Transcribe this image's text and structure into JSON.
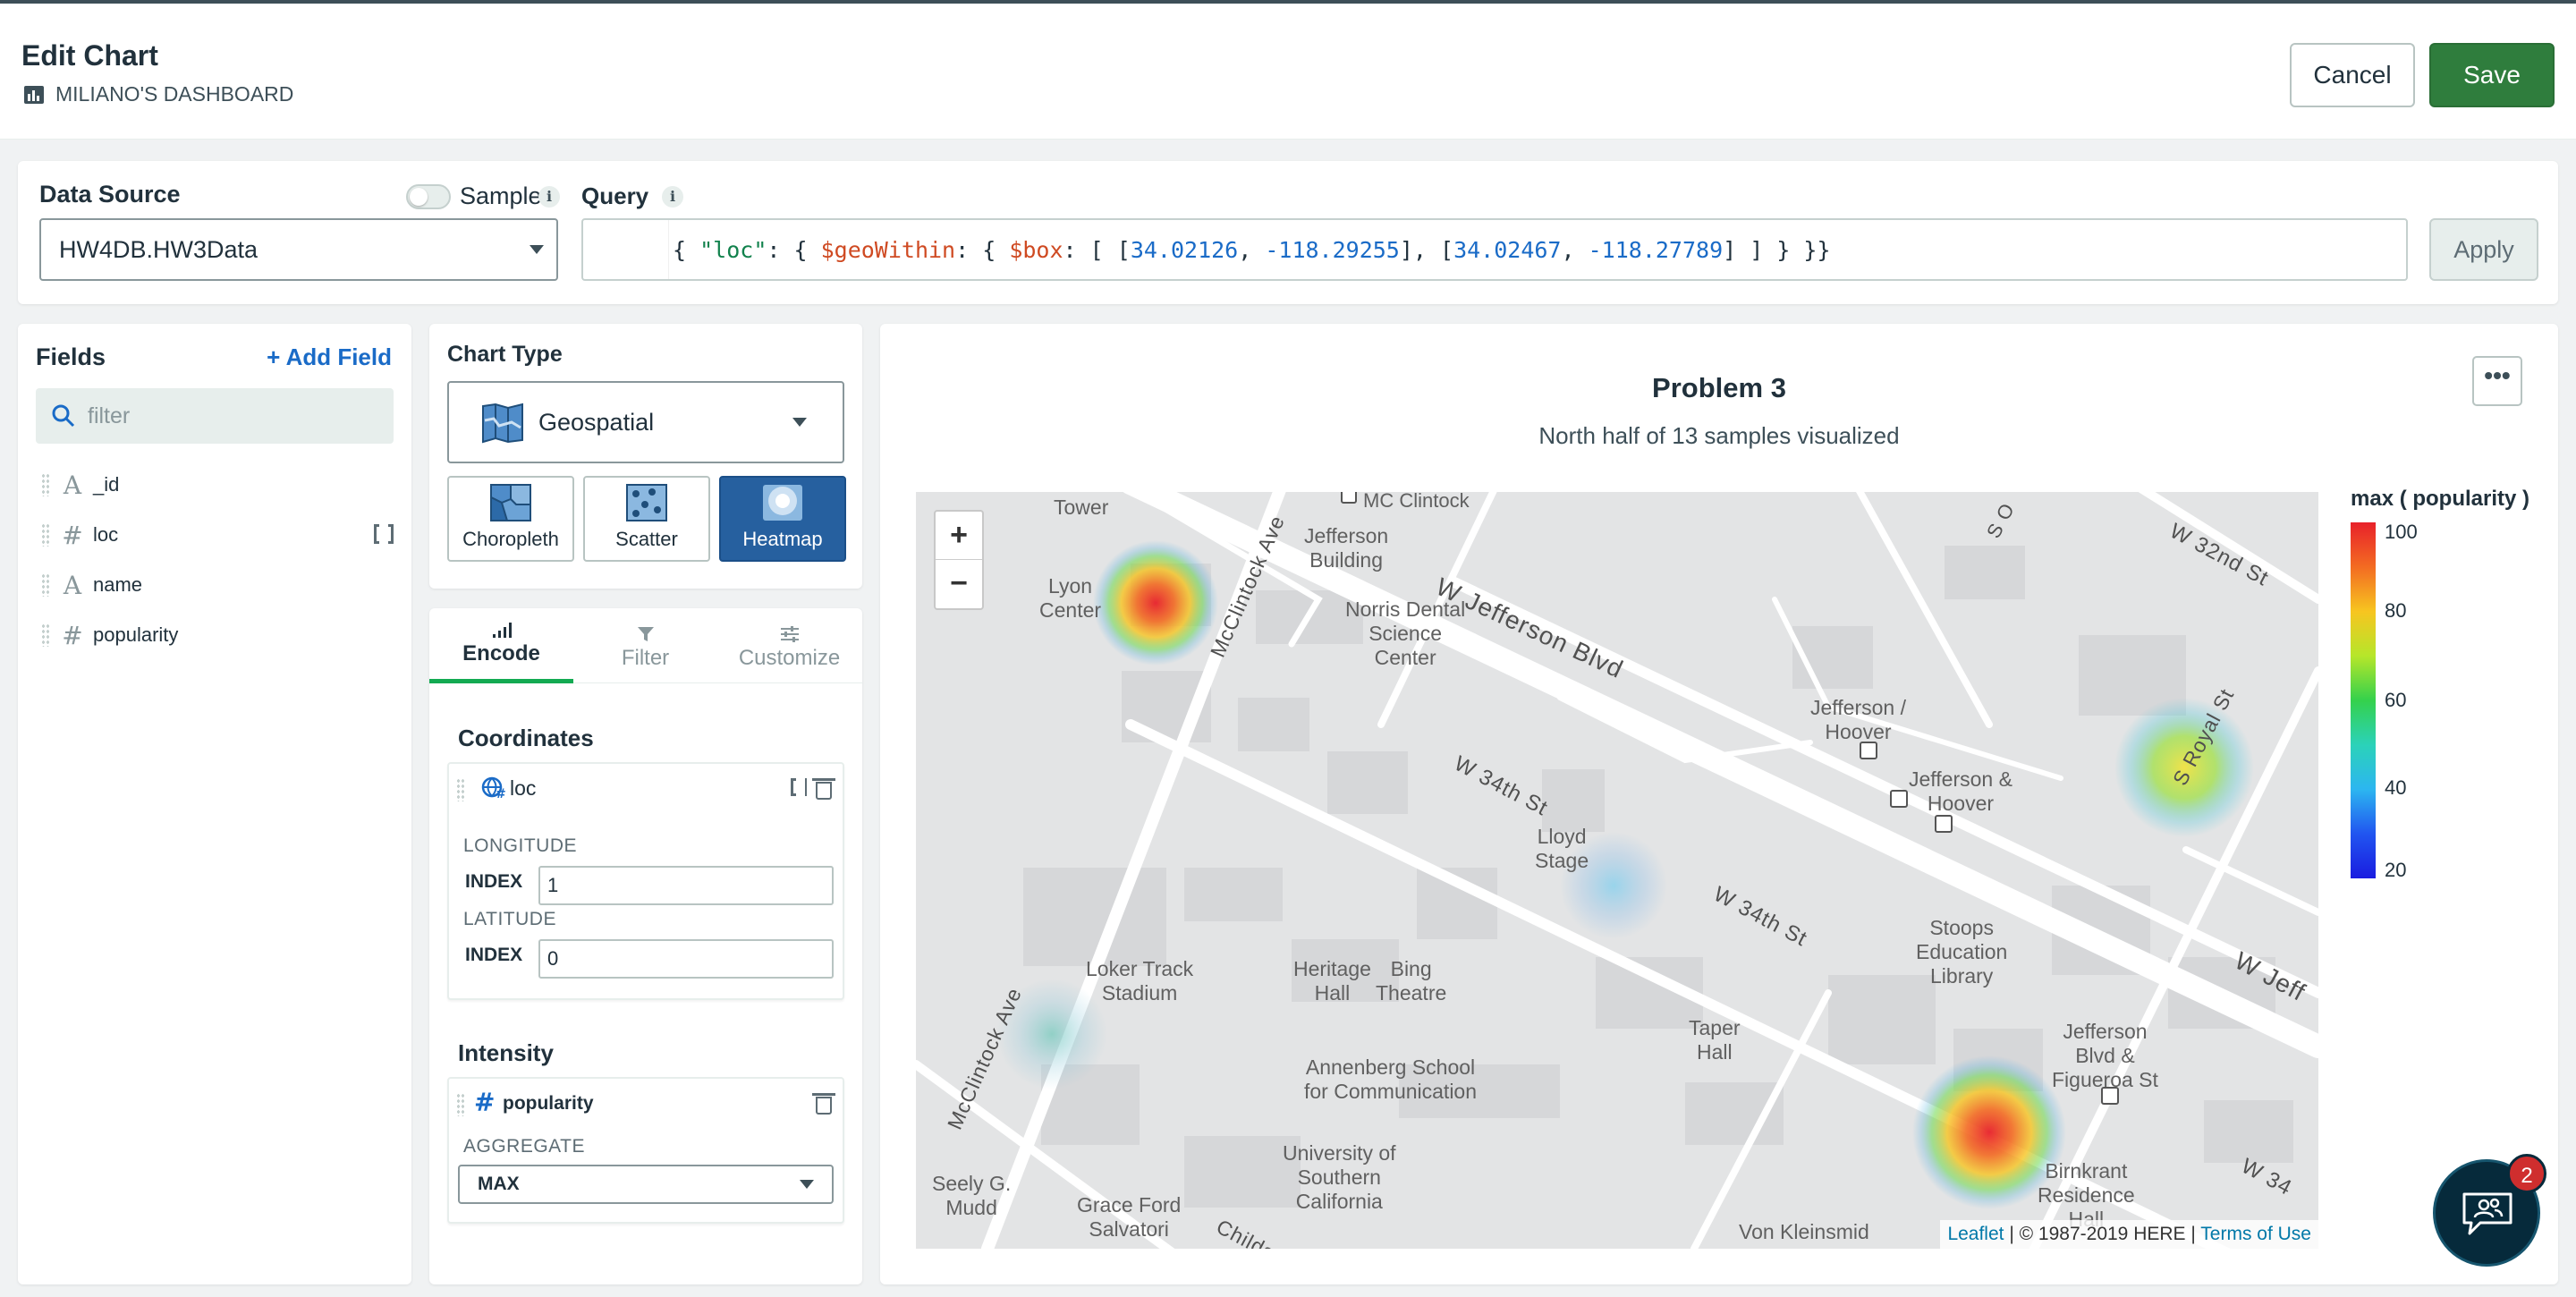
{
  "header": {
    "title": "Edit Chart",
    "dashboard": "MILIANO'S DASHBOARD",
    "cancel_label": "Cancel",
    "save_label": "Save"
  },
  "data_source": {
    "label": "Data Source",
    "sample_label": "Sample",
    "selected": "HW4DB.HW3Data",
    "query_label": "Query",
    "query": {
      "open": "{ ",
      "field": "\"loc\"",
      "op1": "$geoWithin",
      "op2": "$box",
      "c1a": "34.02126",
      "c1b": "-118.29255",
      "c2a": "34.02467",
      "c2b": "-118.27789"
    },
    "apply_label": "Apply"
  },
  "fields": {
    "title": "Fields",
    "add_label": "Add Field",
    "filter_placeholder": "filter",
    "items": [
      {
        "type": "A",
        "name": "_id"
      },
      {
        "type": "#",
        "name": "loc"
      },
      {
        "type": "A",
        "name": "name"
      },
      {
        "type": "#",
        "name": "popularity"
      }
    ]
  },
  "chart_type": {
    "title": "Chart Type",
    "selected": "Geospatial",
    "options": [
      "Choropleth",
      "Scatter",
      "Heatmap"
    ],
    "active": "Heatmap"
  },
  "encode": {
    "tabs": [
      "Encode",
      "Filter",
      "Customize"
    ],
    "active_tab": "Encode",
    "coordinates_title": "Coordinates",
    "coord_field": "loc",
    "longitude_label": "LONGITUDE",
    "latitude_label": "LATITUDE",
    "index_label": "INDEX",
    "longitude_index": "1",
    "latitude_index": "0",
    "intensity_title": "Intensity",
    "intensity_field": "popularity",
    "aggregate_label": "AGGREGATE",
    "aggregate_value": "MAX"
  },
  "chart": {
    "title": "Problem 3",
    "subtitle": "North half of 13 samples visualized",
    "more_label": "•••",
    "legend_title": "max ( popularity )",
    "legend_ticks": [
      "100",
      "80",
      "60",
      "40",
      "20"
    ],
    "zoom_in": "+",
    "zoom_out": "−",
    "attribution_link": "Leaflet",
    "attribution_text": " | © 1987-2019 HERE | ",
    "attribution_terms": "Terms of Use",
    "map_labels": {
      "mcclintock_top": "MC Clintock",
      "tower": "Tower",
      "lyon": "Lyon\nCenter",
      "jefferson_building": "Jefferson\nBuilding",
      "norris": "Norris Dental\nScience\nCenter",
      "jefferson_hoover": "Jefferson /\nHoover",
      "jefferson_and_hoover": "Jefferson &\nHoover",
      "lloyd": "Lloyd\nStage",
      "loker": "Loker Track\nStadium",
      "heritage": "Heritage\nHall",
      "bing": "Bing\nTheatre",
      "stoops": "Stoops\nEducation\nLibrary",
      "taper": "Taper\nHall",
      "annenberg": "Annenberg School\nfor Communication",
      "usc": "University of\nSouthern\nCalifornia",
      "jeff_fig": "Jefferson\nBlvd &\nFigueroa St",
      "birnkrant": "Birnkrant\nResidence\nHall",
      "seeley": "Seely G.\nMudd",
      "grace": "Grace Ford\nSalvatori",
      "von": "Von Kleinsmid",
      "w_jefferson": "W Jefferson Blvd",
      "w_32nd": "W 32nd St",
      "w_34th_a": "W 34th St",
      "w_34th_b": "W 34th St",
      "w_34th_c": "W 34",
      "s_royal": "S Royal St",
      "w_jeff_right": "W Jeff",
      "mcclintock_ave_top": "McClintock Ave",
      "mcclintock_ave_bottom": "McClintock Ave",
      "childs": "Childs",
      "s_o": "S O"
    }
  },
  "chart_data": {
    "type": "heatmap",
    "value_field": "max ( popularity )",
    "scale": [
      20,
      100
    ],
    "points": [
      {
        "label": "Lyon Center",
        "value": 100
      },
      {
        "label": "S Royal St",
        "value": 75
      },
      {
        "label": "Lloyd Stage",
        "value": 45
      },
      {
        "label": "McClintock Ave (south)",
        "value": 40
      },
      {
        "label": "Jefferson Blvd & Figueroa St",
        "value": 100
      }
    ]
  },
  "chat": {
    "badge": "2"
  },
  "colors": {
    "accent_green": "#13aa52",
    "save_green": "#2f7d3d",
    "active_blue": "#26609f",
    "link_blue": "#1a6bc7"
  }
}
